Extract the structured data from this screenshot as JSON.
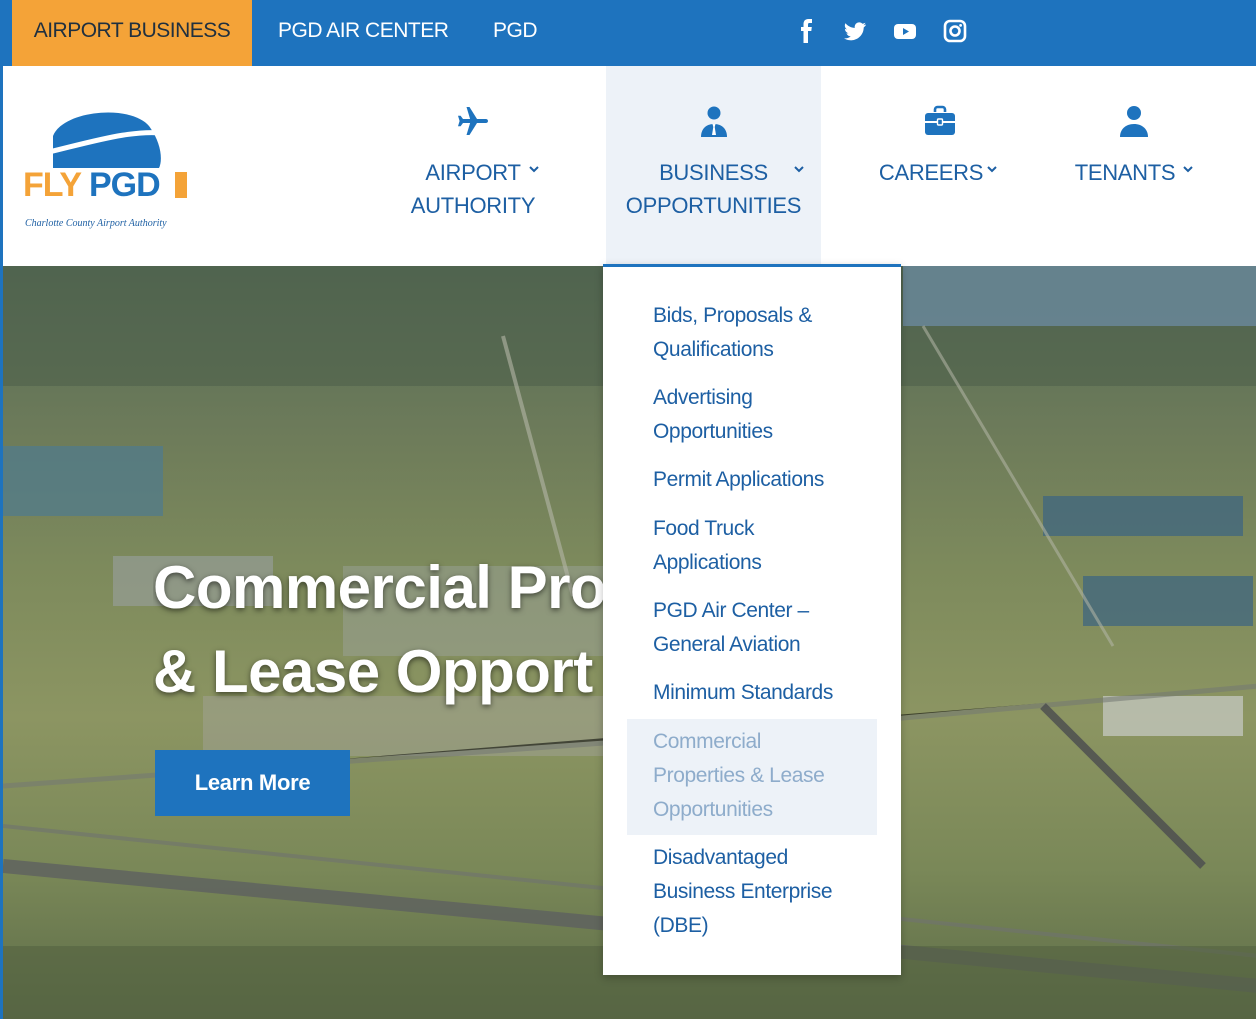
{
  "topbar": {
    "tabs": [
      "AIRPORT BUSINESS",
      "PGD AIR CENTER",
      "PGD"
    ],
    "active_tab": "AIRPORT BUSINESS",
    "social": [
      "facebook-icon",
      "twitter-icon",
      "youtube-icon",
      "instagram-icon"
    ]
  },
  "logo": {
    "text": "FLYPGD",
    "tagline": "Charlotte County Airport Authority",
    "sub": "PGD"
  },
  "nav": {
    "airport": {
      "line1": "AIRPORT",
      "line2": "AUTHORITY",
      "icon": "airplane-icon"
    },
    "business": {
      "line1": "BUSINESS",
      "line2": "OPPORTUNITIES",
      "icon": "business-person-icon"
    },
    "careers": {
      "label": "CAREERS",
      "icon": "briefcase-icon"
    },
    "tenants": {
      "label": "TENANTS",
      "icon": "person-icon"
    }
  },
  "hero": {
    "line1": "Commercial Pro",
    "line2": "& Lease Opport",
    "button": "Learn More"
  },
  "dropdown": {
    "items": [
      {
        "line1": "Bids, Proposals &",
        "line2": "Qualifications"
      },
      {
        "line1": "Advertising",
        "line2": "Opportunities"
      },
      {
        "line1": "Permit Applications"
      },
      {
        "line1": "Food Truck",
        "line2": "Applications"
      },
      {
        "line1": "PGD Air Center –",
        "line2": "General Aviation"
      },
      {
        "line1": "Minimum Standards"
      },
      {
        "line1": "Commercial",
        "line2": "Properties & Lease",
        "line3": "Opportunities",
        "active": true
      },
      {
        "line1": "Disadvantaged",
        "line2": "Business Enterprise",
        "line3": "(DBE)"
      }
    ]
  },
  "colors": {
    "brand_blue": "#1e73be",
    "accent_orange": "#f4a338",
    "nav_text": "#1d5fa3",
    "active_menu_bg": "#edf2f8"
  }
}
